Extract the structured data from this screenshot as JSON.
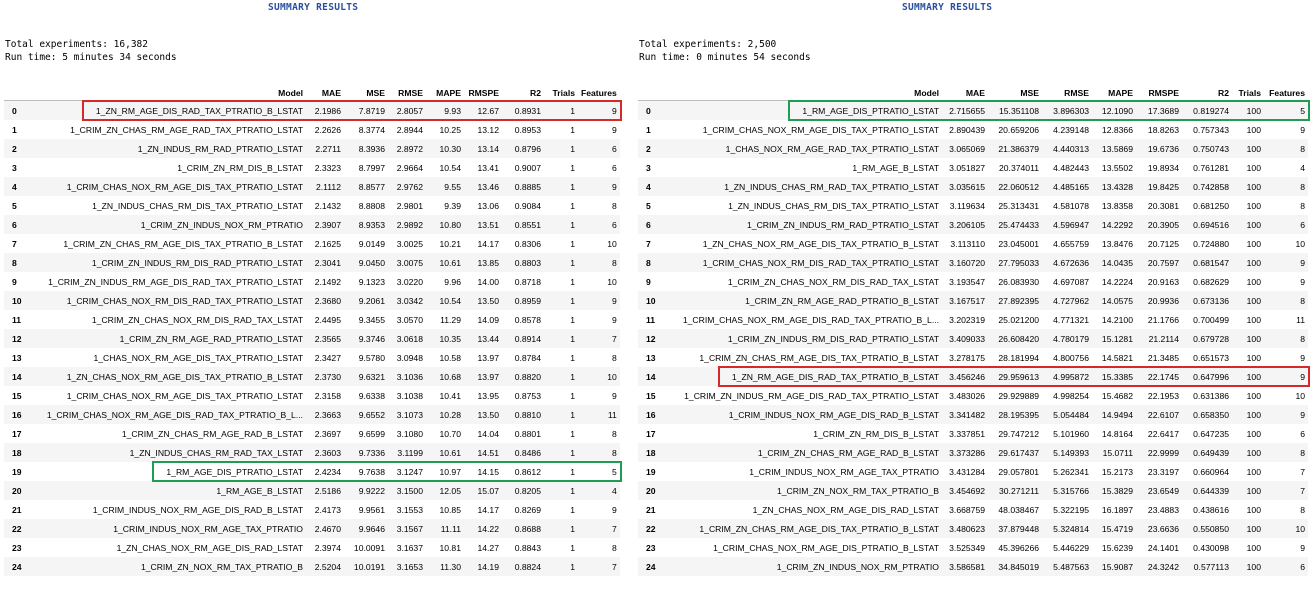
{
  "left": {
    "title": "SUMMARY RESULTS",
    "total_experiments": "Total experiments: 16,382",
    "run_time": "Run time: 5 minutes 34 seconds",
    "columns": [
      "",
      "Model",
      "MAE",
      "MSE",
      "RMSE",
      "MAPE",
      "RMSPE",
      "R2",
      "Trials",
      "Features"
    ],
    "rows": [
      [
        "0",
        "1_ZN_RM_AGE_DIS_RAD_TAX_PTRATIO_B_LSTAT",
        "2.1986",
        "7.8719",
        "2.8057",
        "9.93",
        "12.67",
        "0.8931",
        "1",
        "9"
      ],
      [
        "1",
        "1_CRIM_ZN_CHAS_RM_AGE_RAD_TAX_PTRATIO_LSTAT",
        "2.2626",
        "8.3774",
        "2.8944",
        "10.25",
        "13.12",
        "0.8953",
        "1",
        "9"
      ],
      [
        "2",
        "1_ZN_INDUS_RM_RAD_PTRATIO_LSTAT",
        "2.2711",
        "8.3936",
        "2.8972",
        "10.30",
        "13.14",
        "0.8796",
        "1",
        "6"
      ],
      [
        "3",
        "1_CRIM_ZN_RM_DIS_B_LSTAT",
        "2.3323",
        "8.7997",
        "2.9664",
        "10.54",
        "13.41",
        "0.9007",
        "1",
        "6"
      ],
      [
        "4",
        "1_CRIM_CHAS_NOX_RM_AGE_DIS_TAX_PTRATIO_LSTAT",
        "2.1112",
        "8.8577",
        "2.9762",
        "9.55",
        "13.46",
        "0.8885",
        "1",
        "9"
      ],
      [
        "5",
        "1_ZN_INDUS_CHAS_RM_DIS_TAX_PTRATIO_LSTAT",
        "2.1432",
        "8.8808",
        "2.9801",
        "9.39",
        "13.06",
        "0.9084",
        "1",
        "8"
      ],
      [
        "6",
        "1_CRIM_ZN_INDUS_NOX_RM_PTRATIO",
        "2.3907",
        "8.9353",
        "2.9892",
        "10.80",
        "13.51",
        "0.8551",
        "1",
        "6"
      ],
      [
        "7",
        "1_CRIM_ZN_CHAS_RM_AGE_DIS_TAX_PTRATIO_B_LSTAT",
        "2.1625",
        "9.0149",
        "3.0025",
        "10.21",
        "14.17",
        "0.8306",
        "1",
        "10"
      ],
      [
        "8",
        "1_CRIM_ZN_INDUS_RM_DIS_RAD_PTRATIO_LSTAT",
        "2.3041",
        "9.0450",
        "3.0075",
        "10.61",
        "13.85",
        "0.8803",
        "1",
        "8"
      ],
      [
        "9",
        "1_CRIM_ZN_INDUS_RM_AGE_DIS_RAD_TAX_PTRATIO_LSTAT",
        "2.1492",
        "9.1323",
        "3.0220",
        "9.96",
        "14.00",
        "0.8718",
        "1",
        "10"
      ],
      [
        "10",
        "1_CRIM_CHAS_NOX_RM_DIS_RAD_TAX_PTRATIO_LSTAT",
        "2.3680",
        "9.2061",
        "3.0342",
        "10.54",
        "13.50",
        "0.8959",
        "1",
        "9"
      ],
      [
        "11",
        "1_CRIM_ZN_CHAS_NOX_RM_DIS_RAD_TAX_LSTAT",
        "2.4495",
        "9.3455",
        "3.0570",
        "11.29",
        "14.09",
        "0.8578",
        "1",
        "9"
      ],
      [
        "12",
        "1_CRIM_ZN_RM_AGE_RAD_PTRATIO_LSTAT",
        "2.3565",
        "9.3746",
        "3.0618",
        "10.35",
        "13.44",
        "0.8914",
        "1",
        "7"
      ],
      [
        "13",
        "1_CHAS_NOX_RM_AGE_DIS_TAX_PTRATIO_LSTAT",
        "2.3427",
        "9.5780",
        "3.0948",
        "10.58",
        "13.97",
        "0.8784",
        "1",
        "8"
      ],
      [
        "14",
        "1_ZN_CHAS_NOX_RM_AGE_DIS_TAX_PTRATIO_B_LSTAT",
        "2.3730",
        "9.6321",
        "3.1036",
        "10.68",
        "13.97",
        "0.8820",
        "1",
        "10"
      ],
      [
        "15",
        "1_CRIM_CHAS_NOX_RM_AGE_DIS_TAX_PTRATIO_LSTAT",
        "2.3158",
        "9.6338",
        "3.1038",
        "10.41",
        "13.95",
        "0.8753",
        "1",
        "9"
      ],
      [
        "16",
        "1_CRIM_CHAS_NOX_RM_AGE_DIS_RAD_TAX_PTRATIO_B_L...",
        "2.3663",
        "9.6552",
        "3.1073",
        "10.28",
        "13.50",
        "0.8810",
        "1",
        "11"
      ],
      [
        "17",
        "1_CRIM_ZN_CHAS_RM_AGE_RAD_B_LSTAT",
        "2.3697",
        "9.6599",
        "3.1080",
        "10.70",
        "14.04",
        "0.8801",
        "1",
        "8"
      ],
      [
        "18",
        "1_ZN_INDUS_CHAS_RM_RAD_TAX_LSTAT",
        "2.3603",
        "9.7336",
        "3.1199",
        "10.61",
        "14.51",
        "0.8486",
        "1",
        "8"
      ],
      [
        "19",
        "1_RM_AGE_DIS_PTRATIO_LSTAT",
        "2.4234",
        "9.7638",
        "3.1247",
        "10.97",
        "14.15",
        "0.8612",
        "1",
        "5"
      ],
      [
        "20",
        "1_RM_AGE_B_LSTAT",
        "2.5186",
        "9.9222",
        "3.1500",
        "12.05",
        "15.07",
        "0.8205",
        "1",
        "4"
      ],
      [
        "21",
        "1_CRIM_INDUS_NOX_RM_AGE_DIS_RAD_B_LSTAT",
        "2.4173",
        "9.9561",
        "3.1553",
        "10.85",
        "14.17",
        "0.8269",
        "1",
        "9"
      ],
      [
        "22",
        "1_CRIM_INDUS_NOX_RM_AGE_TAX_PTRATIO",
        "2.4670",
        "9.9646",
        "3.1567",
        "11.11",
        "14.22",
        "0.8688",
        "1",
        "7"
      ],
      [
        "23",
        "1_ZN_CHAS_NOX_RM_AGE_DIS_RAD_LSTAT",
        "2.3974",
        "10.0091",
        "3.1637",
        "10.81",
        "14.27",
        "0.8843",
        "1",
        "8"
      ],
      [
        "24",
        "1_CRIM_ZN_NOX_RM_TAX_PTRATIO_B",
        "2.5204",
        "10.0191",
        "3.1653",
        "11.30",
        "14.19",
        "0.8824",
        "1",
        "7"
      ]
    ],
    "highlights": [
      {
        "row": 0,
        "color": "red"
      },
      {
        "row": 19,
        "color": "green"
      }
    ]
  },
  "right": {
    "title": "SUMMARY RESULTS",
    "total_experiments": "Total experiments: 2,500",
    "run_time": "Run time: 0 minutes 54 seconds",
    "columns": [
      "",
      "Model",
      "MAE",
      "MSE",
      "RMSE",
      "MAPE",
      "RMSPE",
      "R2",
      "Trials",
      "Features"
    ],
    "rows": [
      [
        "0",
        "1_RM_AGE_DIS_PTRATIO_LSTAT",
        "2.715655",
        "15.351108",
        "3.896303",
        "12.1090",
        "17.3689",
        "0.819274",
        "100",
        "5"
      ],
      [
        "1",
        "1_CRIM_CHAS_NOX_RM_AGE_DIS_TAX_PTRATIO_LSTAT",
        "2.890439",
        "20.659206",
        "4.239148",
        "12.8366",
        "18.8263",
        "0.757343",
        "100",
        "9"
      ],
      [
        "2",
        "1_CHAS_NOX_RM_AGE_RAD_TAX_PTRATIO_LSTAT",
        "3.065069",
        "21.386379",
        "4.440313",
        "13.5869",
        "19.6736",
        "0.750743",
        "100",
        "8"
      ],
      [
        "3",
        "1_RM_AGE_B_LSTAT",
        "3.051827",
        "20.374011",
        "4.482443",
        "13.5502",
        "19.8934",
        "0.761281",
        "100",
        "4"
      ],
      [
        "4",
        "1_ZN_INDUS_CHAS_RM_RAD_TAX_PTRATIO_LSTAT",
        "3.035615",
        "22.060512",
        "4.485165",
        "13.4328",
        "19.8425",
        "0.742858",
        "100",
        "8"
      ],
      [
        "5",
        "1_ZN_INDUS_CHAS_RM_DIS_TAX_PTRATIO_LSTAT",
        "3.119634",
        "25.313431",
        "4.581078",
        "13.8358",
        "20.3081",
        "0.681250",
        "100",
        "8"
      ],
      [
        "6",
        "1_CRIM_ZN_INDUS_RM_RAD_PTRATIO_LSTAT",
        "3.206105",
        "25.474433",
        "4.596947",
        "14.2292",
        "20.3905",
        "0.694516",
        "100",
        "6"
      ],
      [
        "7",
        "1_ZN_CHAS_NOX_RM_AGE_DIS_TAX_PTRATIO_B_LSTAT",
        "3.113110",
        "23.045001",
        "4.655759",
        "13.8476",
        "20.7125",
        "0.724880",
        "100",
        "10"
      ],
      [
        "8",
        "1_CRIM_CHAS_NOX_RM_DIS_RAD_TAX_PTRATIO_LSTAT",
        "3.160720",
        "27.795033",
        "4.672636",
        "14.0435",
        "20.7597",
        "0.681547",
        "100",
        "9"
      ],
      [
        "9",
        "1_CRIM_ZN_CHAS_NOX_RM_DIS_RAD_TAX_LSTAT",
        "3.193547",
        "26.083930",
        "4.697087",
        "14.2224",
        "20.9163",
        "0.682629",
        "100",
        "9"
      ],
      [
        "10",
        "1_CRIM_ZN_RM_AGE_RAD_PTRATIO_B_LSTAT",
        "3.167517",
        "27.892395",
        "4.727962",
        "14.0575",
        "20.9936",
        "0.673136",
        "100",
        "8"
      ],
      [
        "11",
        "1_CRIM_CHAS_NOX_RM_AGE_DIS_RAD_TAX_PTRATIO_B_L...",
        "3.202319",
        "25.021200",
        "4.771321",
        "14.2100",
        "21.1766",
        "0.700499",
        "100",
        "11"
      ],
      [
        "12",
        "1_CRIM_ZN_INDUS_RM_DIS_RAD_PTRATIO_LSTAT",
        "3.409033",
        "26.608420",
        "4.780179",
        "15.1281",
        "21.2114",
        "0.679728",
        "100",
        "8"
      ],
      [
        "13",
        "1_CRIM_ZN_CHAS_RM_AGE_DIS_TAX_PTRATIO_B_LSTAT",
        "3.278175",
        "28.181994",
        "4.800756",
        "14.5821",
        "21.3485",
        "0.651573",
        "100",
        "9"
      ],
      [
        "14",
        "1_ZN_RM_AGE_DIS_RAD_TAX_PTRATIO_B_LSTAT",
        "3.456246",
        "29.959613",
        "4.995872",
        "15.3385",
        "22.1745",
        "0.647996",
        "100",
        "9"
      ],
      [
        "15",
        "1_CRIM_ZN_INDUS_RM_AGE_DIS_RAD_TAX_PTRATIO_LSTAT",
        "3.483026",
        "29.929889",
        "4.998254",
        "15.4682",
        "22.1953",
        "0.631386",
        "100",
        "10"
      ],
      [
        "16",
        "1_CRIM_INDUS_NOX_RM_AGE_DIS_RAD_B_LSTAT",
        "3.341482",
        "28.195395",
        "5.054484",
        "14.9494",
        "22.6107",
        "0.658350",
        "100",
        "9"
      ],
      [
        "17",
        "1_CRIM_ZN_RM_DIS_B_LSTAT",
        "3.337851",
        "29.747212",
        "5.101960",
        "14.8164",
        "22.6417",
        "0.647235",
        "100",
        "6"
      ],
      [
        "18",
        "1_CRIM_ZN_CHAS_RM_AGE_RAD_B_LSTAT",
        "3.373286",
        "29.617437",
        "5.149393",
        "15.0711",
        "22.9999",
        "0.649439",
        "100",
        "8"
      ],
      [
        "19",
        "1_CRIM_INDUS_NOX_RM_AGE_TAX_PTRATIO",
        "3.431284",
        "29.057801",
        "5.262341",
        "15.2173",
        "23.3197",
        "0.660964",
        "100",
        "7"
      ],
      [
        "20",
        "1_CRIM_ZN_NOX_RM_TAX_PTRATIO_B",
        "3.454692",
        "30.271211",
        "5.315766",
        "15.3829",
        "23.6549",
        "0.644339",
        "100",
        "7"
      ],
      [
        "21",
        "1_ZN_CHAS_NOX_RM_AGE_DIS_RAD_LSTAT",
        "3.668759",
        "48.038467",
        "5.322195",
        "16.1897",
        "23.4883",
        "0.438616",
        "100",
        "8"
      ],
      [
        "22",
        "1_CRIM_ZN_CHAS_RM_AGE_DIS_TAX_PTRATIO_B_LSTAT",
        "3.480623",
        "37.879448",
        "5.324814",
        "15.4719",
        "23.6636",
        "0.550850",
        "100",
        "10"
      ],
      [
        "23",
        "1_CRIM_CHAS_NOX_RM_AGE_DIS_PTRATIO_B_LSTAT",
        "3.525349",
        "45.396266",
        "5.446229",
        "15.6239",
        "24.1401",
        "0.430098",
        "100",
        "9"
      ],
      [
        "24",
        "1_CRIM_ZN_INDUS_NOX_RM_PTRATIO",
        "3.586581",
        "34.845019",
        "5.487563",
        "15.9087",
        "24.3242",
        "0.577113",
        "100",
        "6"
      ]
    ],
    "highlights": [
      {
        "row": 0,
        "color": "green"
      },
      {
        "row": 14,
        "color": "red"
      }
    ]
  }
}
